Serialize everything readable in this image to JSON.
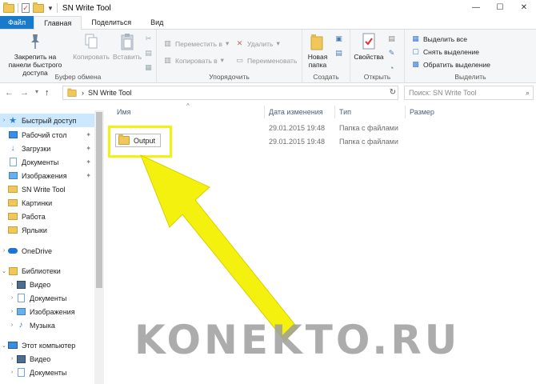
{
  "window": {
    "title": "SN Write Tool",
    "controls": [
      "—",
      "☐",
      "✕"
    ]
  },
  "tabs": [
    "Файл",
    "Главная",
    "Поделиться",
    "Вид"
  ],
  "ribbon": {
    "clipboard": {
      "pin": "Закрепить на панели быстрого доступа",
      "copy": "Копировать",
      "paste": "Вставить",
      "label": "Буфер обмена"
    },
    "organize": {
      "move_to": "Переместить в",
      "copy_to": "Копировать в",
      "delete": "Удалить",
      "rename": "Переименовать",
      "label": "Упорядочить"
    },
    "create": {
      "new_folder": "Новая папка",
      "label": "Создать"
    },
    "open": {
      "properties": "Свойства",
      "label": "Открыть"
    },
    "select": {
      "select_all": "Выделить все",
      "select_none": "Снять выделение",
      "invert": "Обратить выделение",
      "label": "Выделить"
    }
  },
  "address": {
    "path": "SN Write Tool",
    "search_placeholder": "Поиск: SN Write Tool"
  },
  "sidebar": {
    "items": [
      {
        "label": "Быстрый доступ",
        "icon": "star-icon",
        "selected": true
      },
      {
        "label": "Рабочий стол",
        "icon": "desktop-icon",
        "pinned": true
      },
      {
        "label": "Загрузки",
        "icon": "download-icon",
        "pinned": true
      },
      {
        "label": "Документы",
        "icon": "document-icon",
        "pinned": true
      },
      {
        "label": "Изображения",
        "icon": "images-icon",
        "pinned": true
      },
      {
        "label": "SN Write Tool",
        "icon": "folder-icon"
      },
      {
        "label": "Картинки",
        "icon": "folder-icon"
      },
      {
        "label": "Работа",
        "icon": "folder-icon"
      },
      {
        "label": "Ярлыки",
        "icon": "folder-icon"
      },
      {
        "label": "OneDrive",
        "icon": "cloud-icon"
      },
      {
        "label": "Библиотеки",
        "icon": "library-icon"
      },
      {
        "label": "Видео",
        "icon": "video-icon"
      },
      {
        "label": "Документы",
        "icon": "document-icon"
      },
      {
        "label": "Изображения",
        "icon": "images-icon"
      },
      {
        "label": "Музыка",
        "icon": "music-icon"
      },
      {
        "label": "Этот компьютер",
        "icon": "computer-icon"
      },
      {
        "label": "Видео",
        "icon": "video-icon"
      },
      {
        "label": "Документы",
        "icon": "document-icon"
      }
    ]
  },
  "columns": {
    "name": "Имя",
    "date": "Дата изменения",
    "type": "Тип",
    "size": "Размер"
  },
  "files": [
    {
      "name": "",
      "date": "29.01.2015 19:48",
      "type": "Папка с файлами"
    },
    {
      "name": "Output",
      "date": "29.01.2015 19:48",
      "type": "Папка с файлами"
    }
  ],
  "watermark": "KONEKTO.RU",
  "colors": {
    "accent": "#1979ca",
    "highlight": "#f5f10f",
    "selection": "#cce8ff"
  }
}
